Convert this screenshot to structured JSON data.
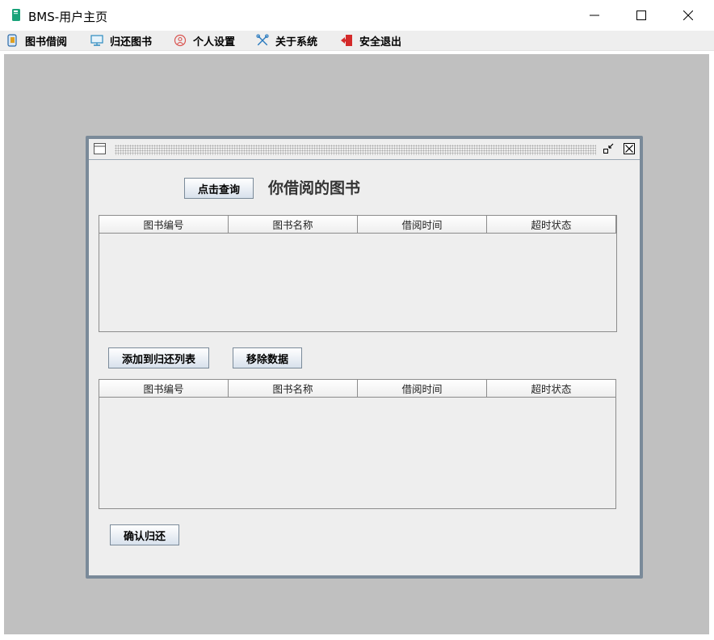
{
  "window": {
    "title": "BMS-用户主页",
    "controls": {
      "minimize": "—",
      "maximize": "☐",
      "close": "✕"
    }
  },
  "menu": [
    {
      "label": "图书借阅",
      "icon": "book-icon"
    },
    {
      "label": "归还图书",
      "icon": "monitor-icon"
    },
    {
      "label": "个人设置",
      "icon": "user-circle-icon"
    },
    {
      "label": "关于系统",
      "icon": "tools-icon"
    },
    {
      "label": "安全退出",
      "icon": "exit-icon"
    }
  ],
  "frame": {
    "query_button": "点击查询",
    "heading": "你借阅的图书",
    "borrowed_table": {
      "columns": [
        "图书编号",
        "图书名称",
        "借阅时间",
        "超时状态"
      ],
      "rows": []
    },
    "add_button": "添加到归还列表",
    "remove_button": "移除数据",
    "return_table": {
      "columns": [
        "图书编号",
        "图书名称",
        "借阅时间",
        "超时状态"
      ],
      "rows": []
    },
    "confirm_button": "确认归还"
  },
  "colors": {
    "desktop": "#c0c0c0",
    "frame_border": "#7a8a99",
    "panel": "#eeeeee",
    "app_icon": "#1aa37a",
    "exit_icon": "#d42a2a"
  }
}
